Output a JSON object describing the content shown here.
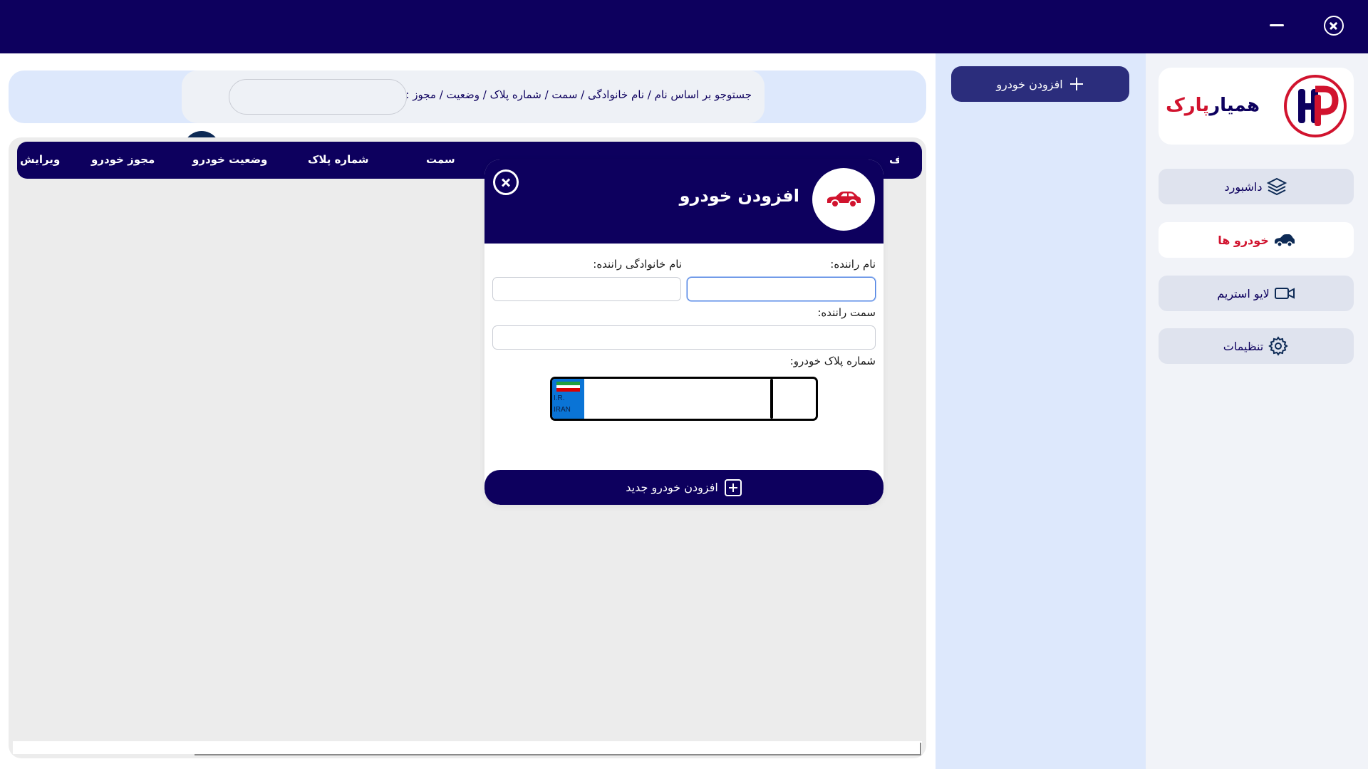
{
  "app": {
    "brand": {
      "part1": "همیار",
      "part2": "پارک"
    },
    "colors": {
      "primary": "#0d005e",
      "accent": "#d1132e",
      "panel": "#dde8fc"
    }
  },
  "window": {
    "minimize_icon": "minimize-icon",
    "close_icon": "close-circle-icon"
  },
  "sidebar": {
    "items": [
      {
        "label": "داشبورد",
        "icon": "layers-icon",
        "active": false
      },
      {
        "label": "خودرو ها",
        "icon": "car-icon",
        "active": true
      },
      {
        "label": "لایو استریم",
        "icon": "video-camera-icon",
        "active": false
      },
      {
        "label": "تنظیمات",
        "icon": "gear-icon",
        "active": false
      }
    ]
  },
  "toolbar": {
    "add_car_label": "افزودن خودرو"
  },
  "search": {
    "hint": "جستوجو بر اساس نام / نام خانوادگی / سمت / شماره پلاک / وضعیت / مجوز :",
    "value": "",
    "placeholder": ""
  },
  "table": {
    "columns": [
      "ویرایش",
      "مجوز خودرو",
      "وضعیت خودرو",
      "شماره پلاک",
      "سمت",
      "حذف"
    ]
  },
  "modal": {
    "title": "افزودن خودرو",
    "fields": {
      "first_name_label": "نام راننده:",
      "last_name_label": "نام خانوادگی راننده:",
      "position_label": "سمت راننده:",
      "plate_label": "شماره پلاک خودرو:"
    },
    "plate": {
      "line1": "I.R.",
      "line2": "IRAN"
    },
    "submit_label": "افزودن خودرو جدید"
  }
}
